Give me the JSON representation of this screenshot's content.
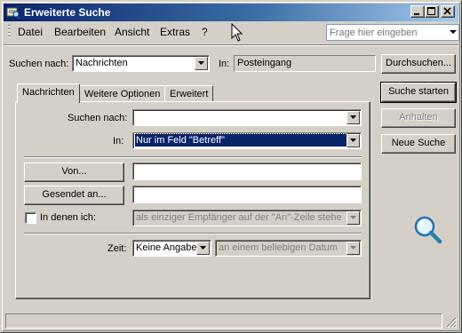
{
  "window": {
    "title": "Erweiterte Suche"
  },
  "menu": {
    "items": [
      {
        "label": "Datei",
        "accel_index": 0
      },
      {
        "label": "Bearbeiten",
        "accel_index": 0
      },
      {
        "label": "Ansicht",
        "accel_index": 0
      },
      {
        "label": "Extras",
        "accel_index": 1
      },
      {
        "label": "?",
        "accel_index": 0
      }
    ],
    "help_placeholder": "Frage hier eingeben"
  },
  "search": {
    "search_for_label": "Suchen nach:",
    "search_for_value": "Nachrichten",
    "in_label": "In:",
    "in_value": "Posteingang",
    "browse_button": "Durchsuchen..."
  },
  "tabs": [
    {
      "label": "Nachrichten",
      "active": true
    },
    {
      "label": "Weitere Optionen",
      "active": false
    },
    {
      "label": "Erweitert",
      "active": false
    }
  ],
  "form": {
    "keyword_label": "Suchen nach:",
    "keyword_value": "",
    "in_field_label": "In:",
    "in_field_value": "Nur im Feld \"Betreff\"",
    "from_button": "Von...",
    "from_value": "",
    "sent_to_button": "Gesendet an...",
    "sent_to_value": "",
    "where_i_am_label": "In denen ich:",
    "where_i_am_checked": false,
    "where_i_am_value": "als einziger Empfänger auf der \"An\"-Zeile stehe",
    "time_label": "Zeit:",
    "time_value": "Keine Angabe",
    "date_value": "an einem beliebigen Datum"
  },
  "actions": {
    "start": "Suche starten",
    "stop": "Anhalten",
    "new_search": "Neue Suche"
  },
  "icons": {
    "app": "outlook-search-icon",
    "animation": "magnifier-icon"
  },
  "colors": {
    "title_start": "#0a246a",
    "title_end": "#a6caf0",
    "face": "#d4d0c8",
    "selection": "#0a246a"
  }
}
